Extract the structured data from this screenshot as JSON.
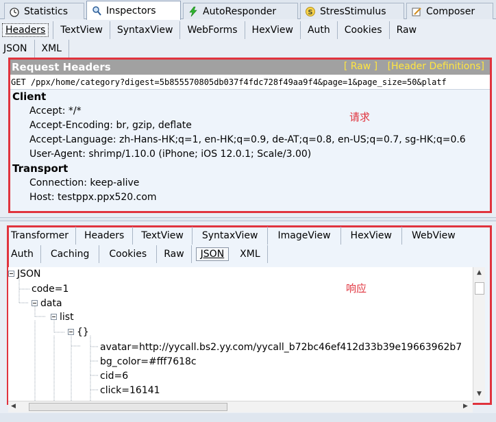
{
  "main_tabs": {
    "statistics": "Statistics",
    "inspectors": "Inspectors",
    "autoresponder": "AutoResponder",
    "stresstimulus": "StresStimulus",
    "composer": "Composer"
  },
  "request_tabs": [
    "Headers",
    "TextView",
    "SyntaxView",
    "WebForms",
    "HexView",
    "Auth",
    "Cookies",
    "Raw"
  ],
  "request_tabs_row2": [
    "JSON",
    "XML"
  ],
  "request": {
    "title": "Request Headers",
    "raw_link": "[ Raw ]",
    "defs_link": "[Header Definitions]",
    "url_line": "GET /ppx/home/category?digest=5b855570805db037f4fdc728f49aa9f4&page=1&page_size=50&platf",
    "client_title": "Client",
    "client_headers": [
      "Accept: */*",
      "Accept-Encoding: br, gzip, deflate",
      "Accept-Language: zh-Hans-HK;q=1, en-HK;q=0.9, de-AT;q=0.8, en-US;q=0.7, sg-HK;q=0.6",
      "User-Agent: shrimp/1.10.0 (iPhone; iOS 12.0.1; Scale/3.00)"
    ],
    "transport_title": "Transport",
    "transport_headers": [
      "Connection: keep-alive",
      "Host: testppx.ppx520.com"
    ],
    "annotation": "请求"
  },
  "response_tabs": [
    "Transformer",
    "Headers",
    "TextView",
    "SyntaxView",
    "ImageView",
    "HexView",
    "WebView"
  ],
  "response_tabs_row2": [
    "Auth",
    "Caching",
    "Cookies",
    "Raw",
    "JSON",
    "XML"
  ],
  "response": {
    "annotation": "响应",
    "tree": {
      "root": "JSON",
      "code": "code=1",
      "data": "data",
      "list": "list",
      "obj": "{}",
      "avatar": "avatar=http://yycall.bs2.yy.com/yycall_b72bc46ef412d33b39e19663962b7",
      "bg_color": "bg_color=#fff7618c",
      "cid": "cid=6",
      "click": "click=16141"
    }
  },
  "colors": {
    "annotation_red": "#e0333d",
    "header_link_yellow": "#ffe640"
  }
}
